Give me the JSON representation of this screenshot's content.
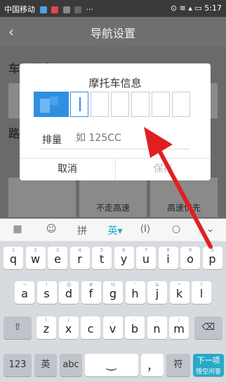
{
  "status_bar": {
    "carrier": "中国移动",
    "time": "5:17"
  },
  "app": {
    "title": "导航设置",
    "section1": "车辆信息",
    "section2": "路线偏好",
    "options": [
      "不走高速",
      "高速优先"
    ]
  },
  "dialog": {
    "title": "摩托车信息",
    "displacement_label": "排量",
    "displacement_placeholder": "如 125CC",
    "cancel": "取消",
    "confirm": "保存"
  },
  "keyboard": {
    "toolbar": [
      "拼",
      "英"
    ],
    "row1": [
      {
        "k": "q",
        "s": "1"
      },
      {
        "k": "w",
        "s": "2"
      },
      {
        "k": "e",
        "s": "3"
      },
      {
        "k": "r",
        "s": "4"
      },
      {
        "k": "t",
        "s": "5"
      },
      {
        "k": "y",
        "s": "6"
      },
      {
        "k": "u",
        "s": "7"
      },
      {
        "k": "i",
        "s": "8"
      },
      {
        "k": "o",
        "s": "9"
      },
      {
        "k": "p",
        "s": "0"
      }
    ],
    "row2": [
      {
        "k": "a",
        "s": "~"
      },
      {
        "k": "s",
        "s": "!"
      },
      {
        "k": "d",
        "s": "@"
      },
      {
        "k": "f",
        "s": "#"
      },
      {
        "k": "g",
        "s": "%"
      },
      {
        "k": "h",
        "s": "'"
      },
      {
        "k": "j",
        "s": "&"
      },
      {
        "k": "k",
        "s": "*"
      },
      {
        "k": "l",
        "s": "?"
      }
    ],
    "row3": [
      {
        "k": "z",
        "s": "("
      },
      {
        "k": "x",
        "s": ")"
      },
      {
        "k": "c",
        "s": "-"
      },
      {
        "k": "v",
        "s": "_"
      },
      {
        "k": "b",
        "s": ":"
      },
      {
        "k": "n",
        "s": ";"
      },
      {
        "k": "m",
        "s": "/"
      }
    ],
    "num_key": "123",
    "lang_key": "英",
    "abc_key": "abc",
    "fu_key": "符",
    "next_key": "下一项",
    "watermark": "悟空问答"
  }
}
